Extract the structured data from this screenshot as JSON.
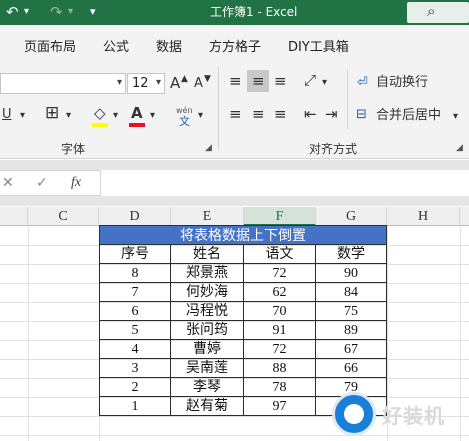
{
  "titlebar": {
    "title": "工作簿1  -  Excel",
    "undo_icon": "↶",
    "redo_icon": "↷",
    "customize_icon": "▾",
    "search_icon": "⌕"
  },
  "tabs": [
    "页面布局",
    "公式",
    "数据",
    "方方格子",
    "DIY工具箱"
  ],
  "ribbon": {
    "font_size": "12",
    "grow_font": "A",
    "shrink_font": "A",
    "font_group_label": "字体",
    "align_group_label": "对齐方式",
    "wrap_text": "自动换行",
    "merge_center": "合并后居中",
    "font_color_letter": "A",
    "phonetic_top": "wén",
    "phonetic_bottom": "文",
    "underline": "U"
  },
  "formula_bar": {
    "cancel": "✕",
    "enter": "✓",
    "fx": "fx",
    "value": ""
  },
  "columns": [
    "C",
    "D",
    "E",
    "F",
    "G",
    "H"
  ],
  "selected_column": "F",
  "sheet": {
    "banner": "将表格数据上下倒置",
    "headers": [
      "序号",
      "姓名",
      "语文",
      "数学"
    ],
    "rows": [
      [
        "8",
        "郑景燕",
        "72",
        "90"
      ],
      [
        "7",
        "何妙海",
        "62",
        "84"
      ],
      [
        "6",
        "冯程悦",
        "70",
        "75"
      ],
      [
        "5",
        "张问筠",
        "91",
        "89"
      ],
      [
        "4",
        "曹婷",
        "72",
        "67"
      ],
      [
        "3",
        "吴南莲",
        "88",
        "66"
      ],
      [
        "2",
        "李琴",
        "78",
        "79"
      ],
      [
        "1",
        "赵有菊",
        "97",
        ""
      ]
    ]
  },
  "watermark": {
    "text": "好装机"
  },
  "colors": {
    "accent": "#217346",
    "banner": "#4472c4"
  }
}
